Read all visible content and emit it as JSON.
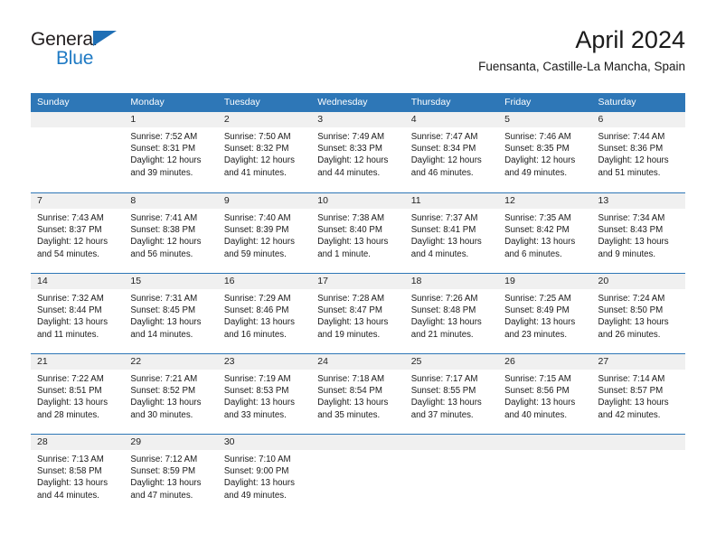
{
  "logo": {
    "word_top": "General",
    "word_bottom": "Blue",
    "triangle_icon": "triangle-icon",
    "accent_color": "#1f7ac4"
  },
  "header": {
    "title": "April 2024",
    "subtitle": "Fuensanta, Castille-La Mancha, Spain"
  },
  "calendar": {
    "header_bg": "#2e77b7",
    "day_band_bg": "#f0f0f0",
    "weekdays": [
      "Sunday",
      "Monday",
      "Tuesday",
      "Wednesday",
      "Thursday",
      "Friday",
      "Saturday"
    ],
    "weeks": [
      [
        {
          "day": "",
          "lines": []
        },
        {
          "day": "1",
          "lines": [
            "Sunrise: 7:52 AM",
            "Sunset: 8:31 PM",
            "Daylight: 12 hours",
            "and 39 minutes."
          ]
        },
        {
          "day": "2",
          "lines": [
            "Sunrise: 7:50 AM",
            "Sunset: 8:32 PM",
            "Daylight: 12 hours",
            "and 41 minutes."
          ]
        },
        {
          "day": "3",
          "lines": [
            "Sunrise: 7:49 AM",
            "Sunset: 8:33 PM",
            "Daylight: 12 hours",
            "and 44 minutes."
          ]
        },
        {
          "day": "4",
          "lines": [
            "Sunrise: 7:47 AM",
            "Sunset: 8:34 PM",
            "Daylight: 12 hours",
            "and 46 minutes."
          ]
        },
        {
          "day": "5",
          "lines": [
            "Sunrise: 7:46 AM",
            "Sunset: 8:35 PM",
            "Daylight: 12 hours",
            "and 49 minutes."
          ]
        },
        {
          "day": "6",
          "lines": [
            "Sunrise: 7:44 AM",
            "Sunset: 8:36 PM",
            "Daylight: 12 hours",
            "and 51 minutes."
          ]
        }
      ],
      [
        {
          "day": "7",
          "lines": [
            "Sunrise: 7:43 AM",
            "Sunset: 8:37 PM",
            "Daylight: 12 hours",
            "and 54 minutes."
          ]
        },
        {
          "day": "8",
          "lines": [
            "Sunrise: 7:41 AM",
            "Sunset: 8:38 PM",
            "Daylight: 12 hours",
            "and 56 minutes."
          ]
        },
        {
          "day": "9",
          "lines": [
            "Sunrise: 7:40 AM",
            "Sunset: 8:39 PM",
            "Daylight: 12 hours",
            "and 59 minutes."
          ]
        },
        {
          "day": "10",
          "lines": [
            "Sunrise: 7:38 AM",
            "Sunset: 8:40 PM",
            "Daylight: 13 hours",
            "and 1 minute."
          ]
        },
        {
          "day": "11",
          "lines": [
            "Sunrise: 7:37 AM",
            "Sunset: 8:41 PM",
            "Daylight: 13 hours",
            "and 4 minutes."
          ]
        },
        {
          "day": "12",
          "lines": [
            "Sunrise: 7:35 AM",
            "Sunset: 8:42 PM",
            "Daylight: 13 hours",
            "and 6 minutes."
          ]
        },
        {
          "day": "13",
          "lines": [
            "Sunrise: 7:34 AM",
            "Sunset: 8:43 PM",
            "Daylight: 13 hours",
            "and 9 minutes."
          ]
        }
      ],
      [
        {
          "day": "14",
          "lines": [
            "Sunrise: 7:32 AM",
            "Sunset: 8:44 PM",
            "Daylight: 13 hours",
            "and 11 minutes."
          ]
        },
        {
          "day": "15",
          "lines": [
            "Sunrise: 7:31 AM",
            "Sunset: 8:45 PM",
            "Daylight: 13 hours",
            "and 14 minutes."
          ]
        },
        {
          "day": "16",
          "lines": [
            "Sunrise: 7:29 AM",
            "Sunset: 8:46 PM",
            "Daylight: 13 hours",
            "and 16 minutes."
          ]
        },
        {
          "day": "17",
          "lines": [
            "Sunrise: 7:28 AM",
            "Sunset: 8:47 PM",
            "Daylight: 13 hours",
            "and 19 minutes."
          ]
        },
        {
          "day": "18",
          "lines": [
            "Sunrise: 7:26 AM",
            "Sunset: 8:48 PM",
            "Daylight: 13 hours",
            "and 21 minutes."
          ]
        },
        {
          "day": "19",
          "lines": [
            "Sunrise: 7:25 AM",
            "Sunset: 8:49 PM",
            "Daylight: 13 hours",
            "and 23 minutes."
          ]
        },
        {
          "day": "20",
          "lines": [
            "Sunrise: 7:24 AM",
            "Sunset: 8:50 PM",
            "Daylight: 13 hours",
            "and 26 minutes."
          ]
        }
      ],
      [
        {
          "day": "21",
          "lines": [
            "Sunrise: 7:22 AM",
            "Sunset: 8:51 PM",
            "Daylight: 13 hours",
            "and 28 minutes."
          ]
        },
        {
          "day": "22",
          "lines": [
            "Sunrise: 7:21 AM",
            "Sunset: 8:52 PM",
            "Daylight: 13 hours",
            "and 30 minutes."
          ]
        },
        {
          "day": "23",
          "lines": [
            "Sunrise: 7:19 AM",
            "Sunset: 8:53 PM",
            "Daylight: 13 hours",
            "and 33 minutes."
          ]
        },
        {
          "day": "24",
          "lines": [
            "Sunrise: 7:18 AM",
            "Sunset: 8:54 PM",
            "Daylight: 13 hours",
            "and 35 minutes."
          ]
        },
        {
          "day": "25",
          "lines": [
            "Sunrise: 7:17 AM",
            "Sunset: 8:55 PM",
            "Daylight: 13 hours",
            "and 37 minutes."
          ]
        },
        {
          "day": "26",
          "lines": [
            "Sunrise: 7:15 AM",
            "Sunset: 8:56 PM",
            "Daylight: 13 hours",
            "and 40 minutes."
          ]
        },
        {
          "day": "27",
          "lines": [
            "Sunrise: 7:14 AM",
            "Sunset: 8:57 PM",
            "Daylight: 13 hours",
            "and 42 minutes."
          ]
        }
      ],
      [
        {
          "day": "28",
          "lines": [
            "Sunrise: 7:13 AM",
            "Sunset: 8:58 PM",
            "Daylight: 13 hours",
            "and 44 minutes."
          ]
        },
        {
          "day": "29",
          "lines": [
            "Sunrise: 7:12 AM",
            "Sunset: 8:59 PM",
            "Daylight: 13 hours",
            "and 47 minutes."
          ]
        },
        {
          "day": "30",
          "lines": [
            "Sunrise: 7:10 AM",
            "Sunset: 9:00 PM",
            "Daylight: 13 hours",
            "and 49 minutes."
          ]
        },
        {
          "day": "",
          "lines": []
        },
        {
          "day": "",
          "lines": []
        },
        {
          "day": "",
          "lines": []
        },
        {
          "day": "",
          "lines": []
        }
      ]
    ]
  }
}
